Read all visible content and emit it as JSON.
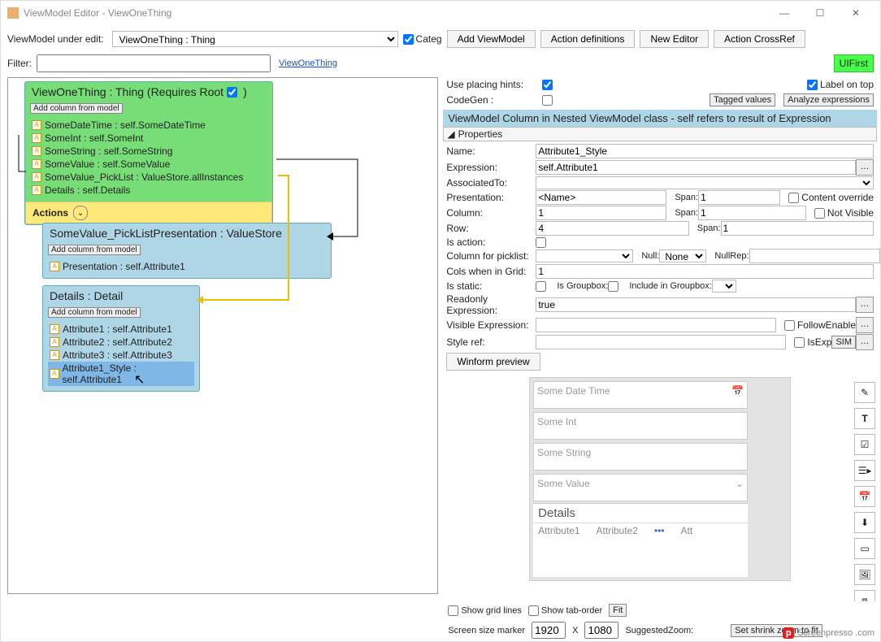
{
  "title": "ViewModel Editor - ViewOneThing",
  "toolbar": {
    "under_edit_lbl": "ViewModel under edit:",
    "under_edit_val": "ViewOneThing : Thing",
    "categ_lbl": "Categ",
    "add_viewmodel": "Add ViewModel",
    "action_defs": "Action definitions",
    "new_editor": "New Editor",
    "action_crossref": "Action CrossRef"
  },
  "row2": {
    "filter_lbl": "Filter:",
    "filter_val": "",
    "link": "ViewOneThing",
    "uifirst": "UIFirst"
  },
  "nodes": {
    "main": {
      "title": "ViewOneThing : Thing  (Requires Root",
      "addcol": "Add column from model",
      "items": [
        "SomeDateTime : self.SomeDateTime",
        "SomeInt : self.SomeInt",
        "SomeString : self.SomeString",
        "SomeValue : self.SomeValue",
        "SomeValue_PickList : ValueStore.allInstances",
        "Details : self.Details"
      ],
      "actions": "Actions"
    },
    "picklist": {
      "title": "SomeValue_PickListPresentation : ValueStore",
      "addcol": "Add column from model",
      "items": [
        "Presentation : self.Attribute1"
      ]
    },
    "details": {
      "title": "Details : Detail",
      "addcol": "Add column from model",
      "items": [
        "Attribute1 : self.Attribute1",
        "Attribute2 : self.Attribute2",
        "Attribute3 : self.Attribute3",
        "Attribute1_Style : self.Attribute1"
      ]
    }
  },
  "cfg": {
    "place_hints": "Use placing hints:",
    "codegen": "CodeGen :",
    "label_on_top": "Label on top",
    "tagged_values": "Tagged values",
    "analyze_expr": "Analyze expressions",
    "section": "ViewModel Column in Nested ViewModel class - self refers to result of Expression",
    "properties": "Properties"
  },
  "form": {
    "name_l": "Name:",
    "name_v": "Attribute1_Style",
    "expr_l": "Expression:",
    "expr_v": "self.Attribute1",
    "assoc_l": "AssociatedTo:",
    "assoc_v": "",
    "pres_l": "Presentation:",
    "pres_v": "<Name>",
    "col_l": "Column:",
    "col_v": "1",
    "row_l": "Row:",
    "row_v": "4",
    "span_l": "Span:",
    "span1_v": "1",
    "span2_v": "1",
    "span3_v": "1",
    "content_override": "Content override",
    "not_visible": "Not Visible",
    "isaction_l": "Is action:",
    "colpick_l": "Column for picklist:",
    "null_l": "Null:",
    "null_v": "None",
    "nullrep_l": "NullRep:",
    "colsgrid_l": "Cols when in Grid:",
    "colsgrid_v": "1",
    "isstatic_l": "Is static:",
    "isgroup_l": "Is Groupbox:",
    "incgroup_l": "Include in Groupbox:",
    "readonly_l": "Readonly Expression:",
    "readonly_v": "true",
    "visible_l": "Visible Expression:",
    "visible_v": "",
    "follow": "FollowEnable",
    "styleref_l": "Style ref:",
    "styleref_v": "",
    "isexp": "IsExp",
    "sim": "SIM",
    "winform": "Winform preview"
  },
  "preview": {
    "c1": "Some Date Time",
    "c2": "Some Int",
    "c3": "Some String",
    "c4": "Some Value",
    "det": "Details",
    "a1": "Attribute1",
    "a2": "Attribute2",
    "a3": "Att"
  },
  "bottom": {
    "showgrid": "Show grid lines",
    "showtab": "Show tab-order",
    "fit": "Fit",
    "marker": "Screen size marker",
    "w": "1920",
    "x": "X",
    "h": "1080",
    "sugg": "SuggestedZoom:",
    "shrink": "Set shrink zoom to fit"
  },
  "footer": "Screenpresso\n.com"
}
